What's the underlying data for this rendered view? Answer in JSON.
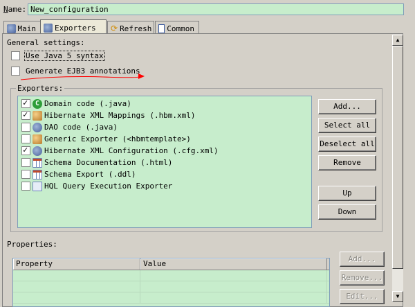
{
  "header": {
    "name_label_prefix": "N",
    "name_label_rest": "ame:",
    "name_value": "New_configuration"
  },
  "tabs": [
    {
      "label": "Main",
      "icon": "main-tab-icon",
      "active": false
    },
    {
      "label": "Exporters",
      "icon": "exporters-tab-icon",
      "active": true
    },
    {
      "label": "Refresh",
      "icon": "refresh-icon",
      "active": false
    },
    {
      "label": "Common",
      "icon": "common-tab-icon",
      "active": false
    }
  ],
  "general": {
    "title": "General settings:",
    "java5": {
      "label": "Use Java 5 syntax",
      "checked": false
    },
    "ejb3": {
      "label": "Generate EJB3 annotations",
      "checked": false
    }
  },
  "exporters": {
    "title": "Exporters:",
    "items": [
      {
        "label": "Domain code (.java)",
        "checked": true,
        "icon": "java-class-icon"
      },
      {
        "label": "Hibernate XML Mappings (.hbm.xml)",
        "checked": true,
        "icon": "hibernate-icon"
      },
      {
        "label": "DAO code (.java)",
        "checked": false,
        "icon": "dao-icon"
      },
      {
        "label": "Generic Exporter (<hbmtemplate>)",
        "checked": false,
        "icon": "generic-exporter-icon"
      },
      {
        "label": "Hibernate XML Configuration (.cfg.xml)",
        "checked": true,
        "icon": "hibernate-config-icon"
      },
      {
        "label": "Schema Documentation (.html)",
        "checked": false,
        "icon": "schema-doc-icon"
      },
      {
        "label": "Schema Export (.ddl)",
        "checked": false,
        "icon": "schema-export-icon"
      },
      {
        "label": "HQL Query Execution Exporter",
        "checked": false,
        "icon": "hql-icon"
      }
    ],
    "buttons": {
      "add": "Add...",
      "select_all": "Select all",
      "deselect_all": "Deselect all",
      "remove": "Remove",
      "up": "Up",
      "down": "Down"
    }
  },
  "properties": {
    "title": "Properties:",
    "columns": [
      "Property",
      "Value"
    ],
    "buttons": {
      "add": "Add...",
      "remove": "Remove...",
      "edit": "Edit..."
    }
  },
  "colors": {
    "list_bg": "#c7edcc",
    "window_bg": "#d4d0c8",
    "annotation_arrow": "#ff0000"
  }
}
